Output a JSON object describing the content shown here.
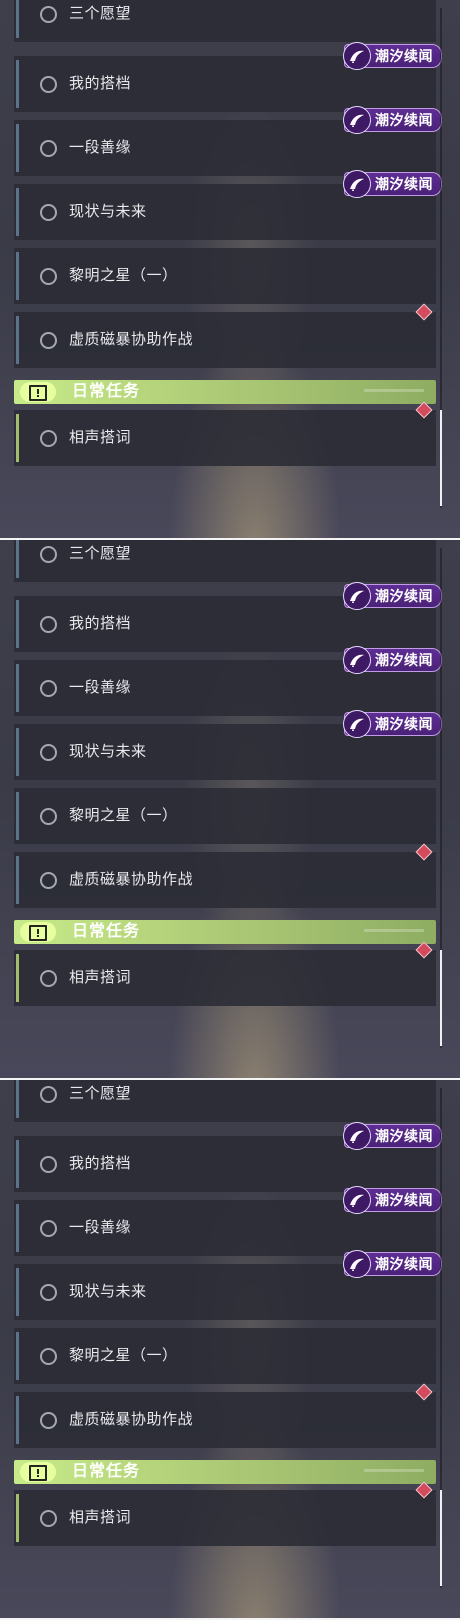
{
  "quests": [
    {
      "label": "三个愿望",
      "badge": null,
      "alert": false
    },
    {
      "label": "我的搭档",
      "badge": "潮汐续闻",
      "alert": false
    },
    {
      "label": "一段善缘",
      "badge": "潮汐续闻",
      "alert": false
    },
    {
      "label": "现状与未来",
      "badge": "潮汐续闻",
      "alert": false
    },
    {
      "label": "黎明之星（一）",
      "badge": null,
      "alert": false
    },
    {
      "label": "虚质磁暴协助作战",
      "badge": null,
      "alert": true
    }
  ],
  "section": {
    "title": "日常任务"
  },
  "daily": {
    "label": "相声搭词",
    "alert": true
  },
  "colors": {
    "section_accent": "#b7d67c",
    "badge_purple": "#5e2e94",
    "alert_red": "#d24a5c",
    "quest_bar": "#5d7389",
    "daily_bar": "#a2bd6c"
  },
  "icons": {
    "radio": "circle-icon",
    "badge": "tide-swirl-icon",
    "section": "exclamation-box-icon",
    "alert": "diamond-alert-icon"
  }
}
